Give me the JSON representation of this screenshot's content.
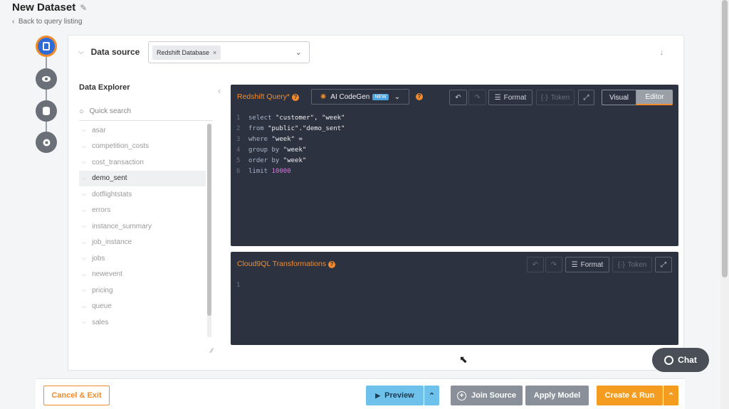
{
  "header": {
    "title": "New Dataset",
    "back_link": "Back to query listing"
  },
  "data_source": {
    "label": "Data source",
    "selected": "Redshift Database",
    "remove": "×"
  },
  "explorer": {
    "title": "Data Explorer",
    "search_placeholder": "Quick search",
    "tables": [
      "asar",
      "competition_costs",
      "cost_transaction",
      "demo_sent",
      "dotflightstats",
      "errors",
      "instance_summary",
      "job_instance",
      "jobs",
      "newevent",
      "pricing",
      "queue",
      "sales"
    ],
    "selected_table": "demo_sent"
  },
  "query_editor": {
    "title": "Redshift Query*",
    "ai_label": "AI CodeGen",
    "ai_badge": "NEW",
    "format_label": "Format",
    "token_label": "Token",
    "visual_label": "Visual",
    "editor_label": "Editor",
    "lines": [
      {
        "n": "1",
        "kw": "select ",
        "rest": "\"customer\", \"week\""
      },
      {
        "n": "2",
        "kw": "from ",
        "rest": "\"public\".\"demo_sent\""
      },
      {
        "n": "3",
        "kw": "where ",
        "rest": "\"week\" ="
      },
      {
        "n": "4",
        "kw": "group by ",
        "rest": "\"week\""
      },
      {
        "n": "5",
        "kw": "order by ",
        "rest": "\"week\""
      },
      {
        "n": "6",
        "kw": "limit ",
        "num": "10000"
      }
    ]
  },
  "transform_editor": {
    "title": "Cloud9QL Transformations",
    "format_label": "Format",
    "token_label": "Token",
    "line1": "1"
  },
  "footer": {
    "cancel": "Cancel & Exit",
    "preview": "Preview",
    "join": "Join Source",
    "apply": "Apply Model",
    "create": "Create & Run"
  },
  "chat": {
    "label": "Chat"
  },
  "colors": {
    "accent": "#f38b2a",
    "editor_bg": "#2c3240",
    "preview_bg": "#6ec1ea",
    "create_bg": "#f39c1f",
    "gray_btn": "#8a9099"
  }
}
